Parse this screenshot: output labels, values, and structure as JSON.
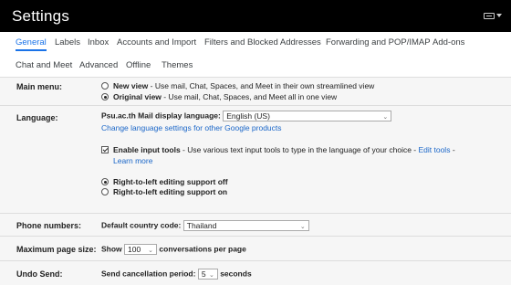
{
  "header": {
    "title": "Settings",
    "input_tools_icon": "keyboard-icon"
  },
  "tabs_row1": [
    "General",
    "Labels",
    "Inbox",
    "Accounts and Import",
    "Filters and Blocked Addresses",
    "Forwarding and POP/IMAP",
    "Add-ons"
  ],
  "tabs_row2": [
    "Chat and Meet",
    "Advanced",
    "Offline",
    "Themes"
  ],
  "colors": {
    "active_tab": "#1a73e8",
    "link": "#1a66c8",
    "header_bg": "#000000",
    "panel_bg": "#f6f6f6"
  },
  "main_menu": {
    "label": "Main menu:",
    "option1_name": "New view",
    "option1_desc": " - Use mail, Chat, Spaces, and Meet in their own streamlined view",
    "option2_name": "Original view",
    "option2_desc": " - Use mail, Chat, Spaces, and Meet all in one view"
  },
  "language": {
    "label": "Language:",
    "display_label": "Psu.ac.th Mail display language:",
    "display_value": "English (US)",
    "change_link": "Change language settings for other Google products",
    "input_tools_name": "Enable input tools",
    "input_tools_desc": " - Use various text input tools to type in the language of your choice - ",
    "edit_tools_link": "Edit tools",
    "dash": " -",
    "learn_more": "Learn more",
    "rtl_off": "Right-to-left editing support off",
    "rtl_on": "Right-to-left editing support on"
  },
  "phone": {
    "label": "Phone numbers:",
    "field_label": "Default country code:",
    "value": "Thailand"
  },
  "page_size": {
    "label": "Maximum page size:",
    "show": "Show",
    "value": "100",
    "suffix": "conversations per page"
  },
  "undo_send": {
    "label": "Undo Send:",
    "field_label": "Send cancellation period:",
    "value": "5",
    "suffix": "seconds"
  }
}
